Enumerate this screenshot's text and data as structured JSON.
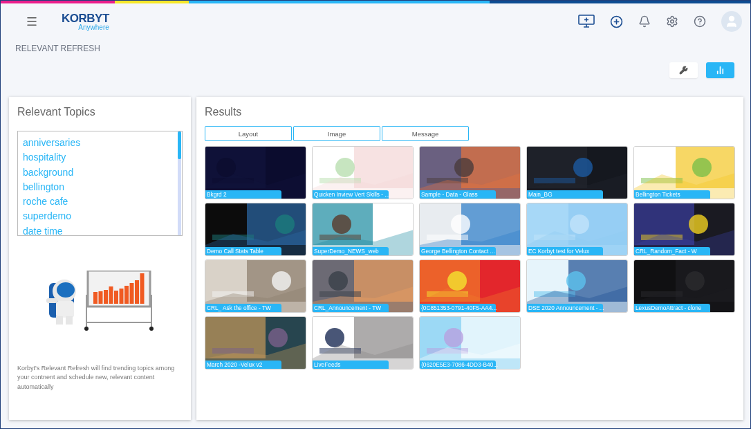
{
  "top_bar": {
    "logo": {
      "name": "KORBYT",
      "tagline": "Anywhere"
    }
  },
  "page": {
    "title": "RELEVANT REFRESH"
  },
  "topics_panel": {
    "title": "Relevant Topics",
    "topics": [
      "anniversaries",
      "hospitality",
      "background",
      "bellington",
      "roche cafe",
      "superdemo",
      "date time"
    ],
    "description": "Korbyt's Relevant Refresh will find trending topics among your contnent and schedule new, relevant content automatically"
  },
  "results_panel": {
    "title": "Results",
    "filters": [
      "Layout",
      "Image",
      "Message"
    ],
    "items": [
      {
        "label": "Bkgrd 2"
      },
      {
        "label": "Quicken Inview Vert Skills - ..."
      },
      {
        "label": "Sample - Data - Glass"
      },
      {
        "label": "Main_BG"
      },
      {
        "label": "Bellington Tickets"
      },
      {
        "label": "Demo Call Stats Table"
      },
      {
        "label": "SuperDemo_NEWS_web"
      },
      {
        "label": "George Bellington Contact ..."
      },
      {
        "label": "EC Korbyt test for Velux"
      },
      {
        "label": "CRL_Random_Fact - W"
      },
      {
        "label": "CRL_ Ask the office - TW"
      },
      {
        "label": "CRL_Announcement - TW"
      },
      {
        "label": "{0C851353-0791-40F5-AA4..."
      },
      {
        "label": "DSE 2020 Announcement - ..."
      },
      {
        "label": "LexusDemoAttract - clone"
      },
      {
        "label": "March 2020 -Velux v2"
      },
      {
        "label": "LiveFeeds"
      },
      {
        "label": "{0620E5E3-7086-4DD3-B40..."
      }
    ]
  }
}
